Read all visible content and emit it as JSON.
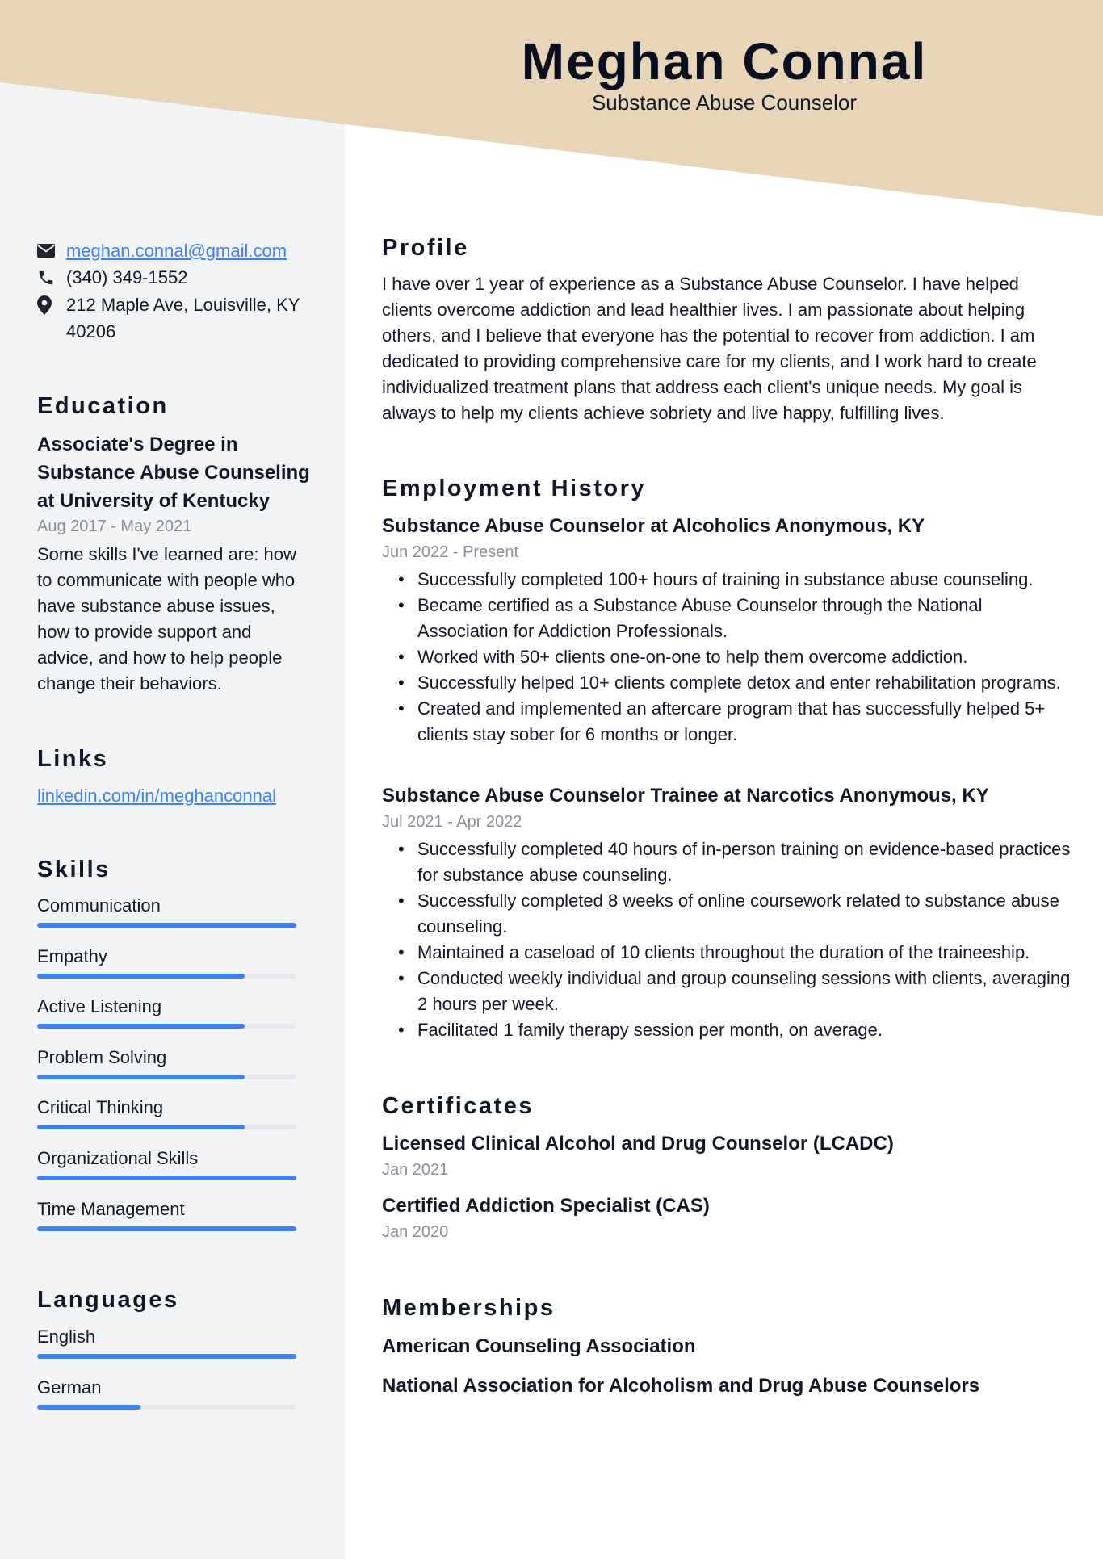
{
  "colors": {
    "header_band": "#e8d5b7",
    "sidebar_bg": "#f2f3f5",
    "accent_blue": "#3b82f6",
    "bar_track": "#e5e7eb",
    "muted_text": "#8a8f98"
  },
  "header": {
    "name": "Meghan Connal",
    "job_title": "Substance Abuse Counselor"
  },
  "contact": {
    "email": "meghan.connal@gmail.com",
    "email_icon": "envelope-icon",
    "phone": "(340) 349-1552",
    "phone_icon": "phone-icon",
    "address": "212 Maple Ave, Louisville, KY 40206",
    "address_icon": "map-pin-icon"
  },
  "education": {
    "heading": "Education",
    "degree": "Associate's Degree in Substance Abuse Counseling at University of Kentucky",
    "dates": "Aug 2017 - May 2021",
    "description": "Some skills I've learned are: how to communicate with people who have substance abuse issues, how to provide support and advice, and how to help people change their behaviors."
  },
  "links": {
    "heading": "Links",
    "items": [
      {
        "label": "linkedin.com/in/meghanconnal"
      }
    ]
  },
  "skills": {
    "heading": "Skills",
    "items": [
      {
        "label": "Communication",
        "level_percent": 100
      },
      {
        "label": "Empathy",
        "level_percent": 80
      },
      {
        "label": "Active Listening",
        "level_percent": 80
      },
      {
        "label": "Problem Solving",
        "level_percent": 80
      },
      {
        "label": "Critical Thinking",
        "level_percent": 80
      },
      {
        "label": "Organizational Skills",
        "level_percent": 100
      },
      {
        "label": "Time Management",
        "level_percent": 100
      }
    ]
  },
  "languages": {
    "heading": "Languages",
    "items": [
      {
        "label": "English",
        "level_percent": 100
      },
      {
        "label": "German",
        "level_percent": 40
      }
    ]
  },
  "profile": {
    "heading": "Profile",
    "text": "I have over 1 year of experience as a Substance Abuse Counselor. I have helped clients overcome addiction and lead healthier lives. I am passionate about helping others, and I believe that everyone has the potential to recover from addiction. I am dedicated to providing comprehensive care for my clients, and I work hard to create individualized treatment plans that address each client's unique needs. My goal is always to help my clients achieve sobriety and live happy, fulfilling lives."
  },
  "employment": {
    "heading": "Employment History",
    "jobs": [
      {
        "title": "Substance Abuse Counselor at Alcoholics Anonymous, KY",
        "dates": "Jun 2022 - Present",
        "bullets": [
          "Successfully completed 100+ hours of training in substance abuse counseling.",
          "Became certified as a Substance Abuse Counselor through the National Association for Addiction Professionals.",
          "Worked with 50+ clients one-on-one to help them overcome addiction.",
          "Successfully helped 10+ clients complete detox and enter rehabilitation programs.",
          "Created and implemented an aftercare program that has successfully helped 5+ clients stay sober for 6 months or longer."
        ]
      },
      {
        "title": "Substance Abuse Counselor Trainee at Narcotics Anonymous, KY",
        "dates": "Jul 2021 - Apr 2022",
        "bullets": [
          "Successfully completed 40 hours of in-person training on evidence-based practices for substance abuse counseling.",
          "Successfully completed 8 weeks of online coursework related to substance abuse counseling.",
          "Maintained a caseload of 10 clients throughout the duration of the traineeship.",
          "Conducted weekly individual and group counseling sessions with clients, averaging 2 hours per week.",
          "Facilitated 1 family therapy session per month, on average."
        ]
      }
    ]
  },
  "certificates": {
    "heading": "Certificates",
    "items": [
      {
        "title": "Licensed Clinical Alcohol and Drug Counselor (LCADC)",
        "date": "Jan 2021"
      },
      {
        "title": "Certified Addiction Specialist (CAS)",
        "date": "Jan 2020"
      }
    ]
  },
  "memberships": {
    "heading": "Memberships",
    "items": [
      "American Counseling Association",
      "National Association for Alcoholism and Drug Abuse Counselors"
    ]
  }
}
